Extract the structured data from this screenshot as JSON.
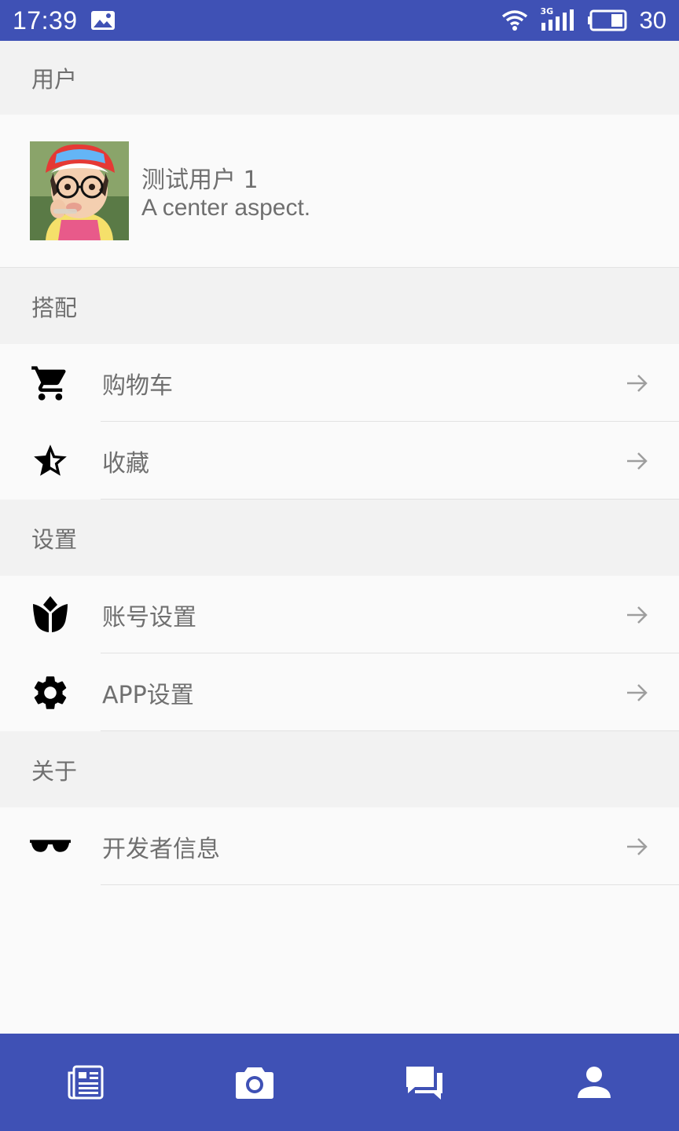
{
  "status_bar": {
    "time": "17:39",
    "network": "3G",
    "battery": "30",
    "icons": [
      "image-icon",
      "wifi-icon",
      "signal-icon",
      "battery-icon"
    ]
  },
  "sections": {
    "user": "用户",
    "match": "搭配",
    "settings": "设置",
    "about": "关于"
  },
  "user": {
    "name": "测试用户 1",
    "bio": "A center aspect."
  },
  "menu": {
    "cart": {
      "label": "购物车",
      "icon": "cart-icon"
    },
    "favorites": {
      "label": "收藏",
      "icon": "star-half-icon"
    },
    "account": {
      "label": "账号设置",
      "icon": "flower-icon"
    },
    "app_settings": {
      "label": "APP设置",
      "icon": "gear-icon"
    },
    "developer": {
      "label": "开发者信息",
      "icon": "sunglasses-icon"
    }
  },
  "bottom_nav": [
    "news-icon",
    "camera-icon",
    "chat-icon",
    "person-icon"
  ],
  "colors": {
    "primary": "#3f51b5",
    "section_bg": "#f2f2f2",
    "background": "#fafafa",
    "text": "#707070"
  }
}
